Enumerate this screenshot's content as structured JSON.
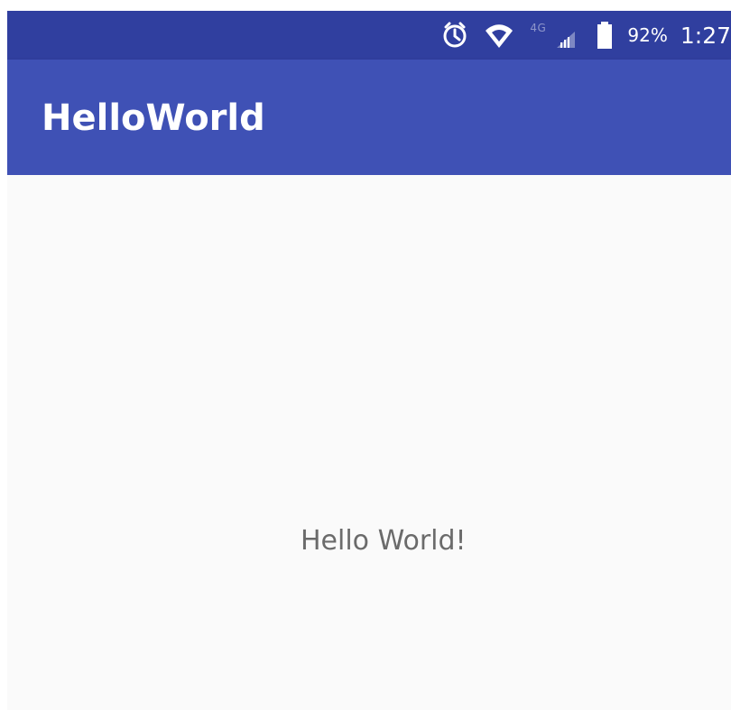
{
  "status_bar": {
    "network_label": "4G",
    "battery_percent": "92%",
    "time": "1:27",
    "icons": [
      "alarm-icon",
      "wifi-icon",
      "signal-icon",
      "battery-icon"
    ]
  },
  "app_bar": {
    "title": "HelloWorld"
  },
  "content": {
    "message": "Hello World!"
  },
  "colors": {
    "status_bar": "#303f9f",
    "app_bar": "#3f51b5",
    "background": "#fafafa",
    "text": "#6b6b6b"
  }
}
